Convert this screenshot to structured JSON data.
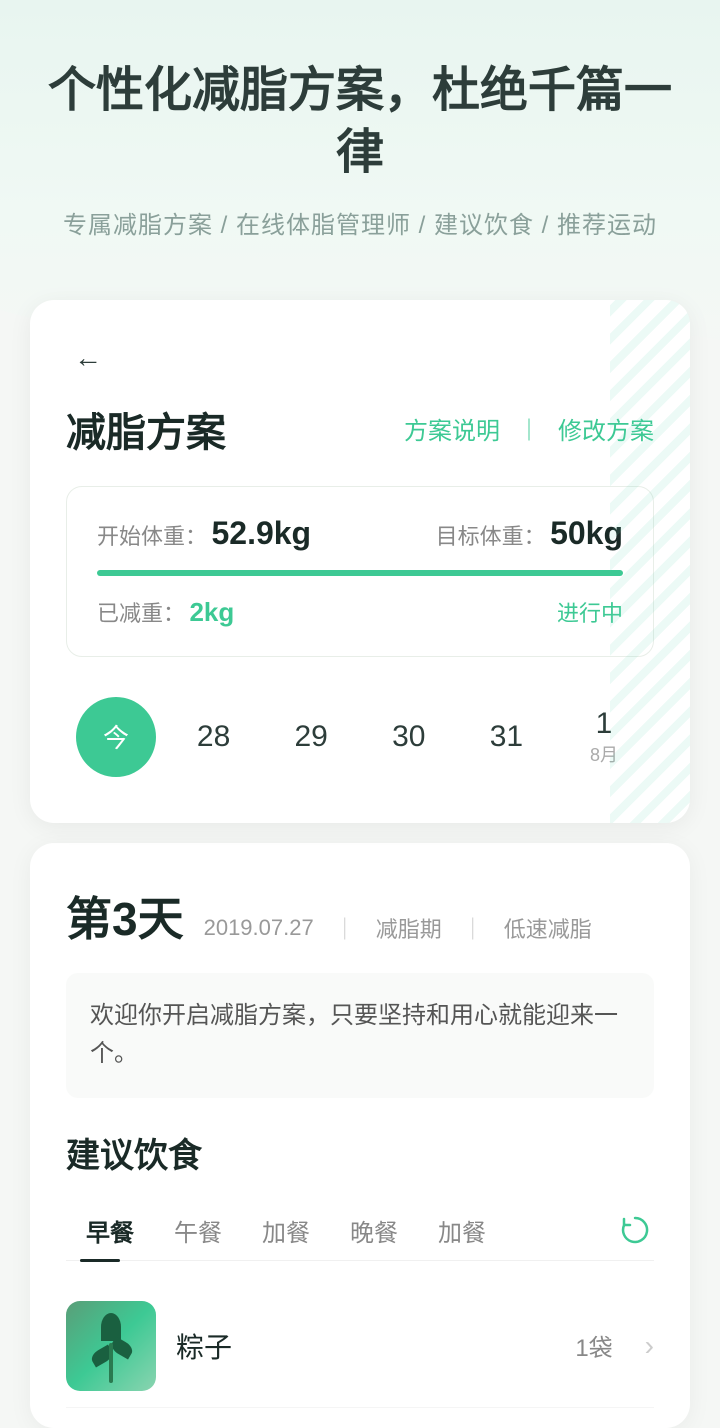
{
  "hero": {
    "title": "个性化减脂方案，杜绝千篇一律",
    "subtitle": "专属减脂方案 / 在线体脂管理师 / 建议饮食 / 推荐运动"
  },
  "card": {
    "back_label": "←",
    "title": "减脂方案",
    "action_explain": "方案说明",
    "action_divider": "｜",
    "action_modify": "修改方案",
    "weight_start_label": "开始体重：",
    "weight_start_value": "52.9kg",
    "weight_target_label": "目标体重：",
    "weight_target_value": "50kg",
    "weight_lost_label": "已减重：",
    "weight_lost_value": "2kg",
    "status": "进行中"
  },
  "calendar": {
    "items": [
      {
        "day": "今",
        "month": "",
        "is_today": true
      },
      {
        "day": "28",
        "month": "",
        "is_today": false
      },
      {
        "day": "29",
        "month": "",
        "is_today": false
      },
      {
        "day": "30",
        "month": "",
        "is_today": false
      },
      {
        "day": "31",
        "month": "",
        "is_today": false
      },
      {
        "day": "1",
        "month": "8月",
        "is_today": false
      }
    ]
  },
  "day_section": {
    "day_number": "第3天",
    "date": "2019.07.27",
    "sep": "｜",
    "phase": "减脂期",
    "type": "低速减脂",
    "welcome": "欢迎你开启减脂方案，只要坚持和用心就能迎来一个。"
  },
  "diet": {
    "title": "建议饮食",
    "tabs": [
      {
        "label": "早餐",
        "active": true
      },
      {
        "label": "午餐",
        "active": false
      },
      {
        "label": "加餐",
        "active": false
      },
      {
        "label": "晚餐",
        "active": false
      },
      {
        "label": "加餐",
        "active": false
      }
    ],
    "refresh_label": "refresh",
    "food_items": [
      {
        "name": "粽子",
        "qty": "1袋",
        "img_alt": "food-image"
      }
    ]
  }
}
